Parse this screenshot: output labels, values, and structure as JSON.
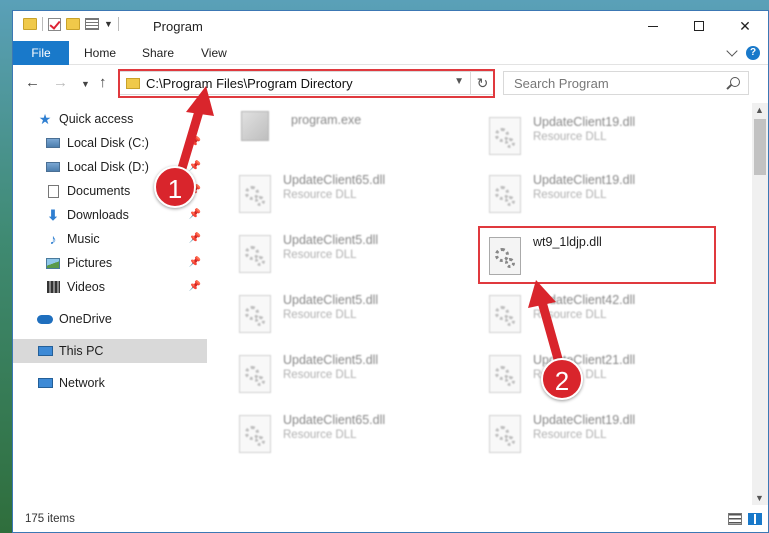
{
  "window": {
    "title": "Program",
    "controls": {
      "minimize": "minimize",
      "maximize": "maximize",
      "close": "✕"
    }
  },
  "ribbon": {
    "tabs": [
      "File",
      "Home",
      "Share",
      "View"
    ],
    "help": "?"
  },
  "address": {
    "path": "C:\\Program Files\\Program Directory",
    "search_placeholder": "Search Program"
  },
  "sidebar": {
    "items": [
      {
        "label": "Quick access",
        "icon": "star-icon"
      },
      {
        "label": "Local Disk (C:)",
        "icon": "disk-icon",
        "pinned": true
      },
      {
        "label": "Local Disk (D:)",
        "icon": "disk-icon",
        "pinned": true
      },
      {
        "label": "Documents",
        "icon": "document-icon",
        "pinned": true
      },
      {
        "label": "Downloads",
        "icon": "download-icon",
        "pinned": true
      },
      {
        "label": "Music",
        "icon": "music-icon",
        "pinned": true
      },
      {
        "label": "Pictures",
        "icon": "pictures-icon",
        "pinned": true
      },
      {
        "label": "Videos",
        "icon": "videos-icon",
        "pinned": true
      },
      {
        "label": "OneDrive",
        "icon": "cloud-icon"
      },
      {
        "label": "This PC",
        "icon": "computer-icon",
        "selected": true
      },
      {
        "label": "Network",
        "icon": "network-icon"
      }
    ]
  },
  "files": {
    "left": [
      {
        "name": "program.exe",
        "type": ""
      },
      {
        "name": "UpdateClient65.dll",
        "type": "Resource DLL"
      },
      {
        "name": "UpdateClient5.dll",
        "type": "Resource DLL"
      },
      {
        "name": "UpdateClient5.dll",
        "type": "Resource DLL"
      },
      {
        "name": "UpdateClient5.dll",
        "type": "Resource DLL"
      },
      {
        "name": "UpdateClient65.dll",
        "type": "Resource DLL"
      }
    ],
    "right": [
      {
        "name": "UpdateClient19.dll",
        "type": "Resource DLL"
      },
      {
        "name": "UpdateClient19.dll",
        "type": "Resource DLL"
      },
      {
        "name": "wt9_1ldjp.dll",
        "type": ""
      },
      {
        "name": "UpdateClient42.dll",
        "type": "Resource DLL"
      },
      {
        "name": "UpdateClient21.dll",
        "type": "Resource DLL"
      },
      {
        "name": "UpdateClient19.dll",
        "type": "Resource DLL"
      }
    ]
  },
  "status": {
    "item_count": "175 items"
  },
  "annotations": {
    "step1": "1",
    "step2": "2",
    "color": "#d9252c"
  }
}
